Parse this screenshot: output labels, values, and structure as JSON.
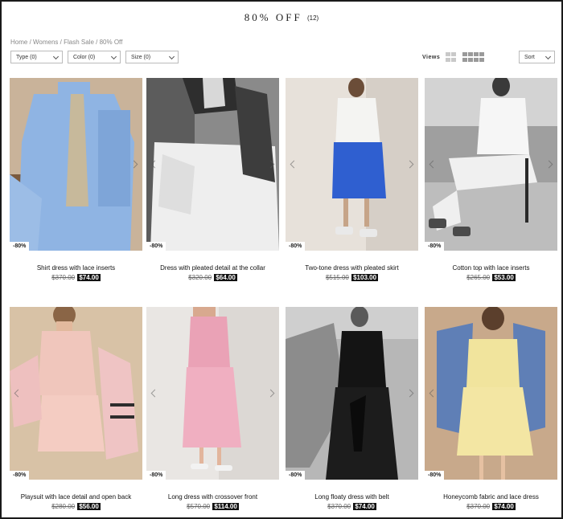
{
  "header": {
    "title": "80% OFF",
    "count": "(12)"
  },
  "breadcrumb": [
    "Home",
    "Womens",
    "Flash Sale",
    "80% Off"
  ],
  "breadcrumb_sep": " / ",
  "filters": {
    "type": "Type (0)",
    "color": "Color (0)",
    "size": "Size (0)"
  },
  "views_label": "Views",
  "sort_label": "Sort",
  "colors": {
    "price_badge_bg": "#111111",
    "price_badge_text": "#ffffff"
  },
  "products": [
    {
      "name": "Shirt dress with lace inserts",
      "old_price": "$370.00",
      "new_price": "$74.00",
      "discount": "-80%"
    },
    {
      "name": "Dress with pleated detail at the collar",
      "old_price": "$320.00",
      "new_price": "$64.00",
      "discount": "-80%"
    },
    {
      "name": "Two-tone dress with pleated skirt",
      "old_price": "$515.00",
      "new_price": "$103.00",
      "discount": "-80%"
    },
    {
      "name": "Cotton top with lace inserts",
      "old_price": "$265.00",
      "new_price": "$53.00",
      "discount": "-80%"
    },
    {
      "name": "Playsuit with lace detail and open back",
      "old_price": "$280.00",
      "new_price": "$56.00",
      "discount": "-80%"
    },
    {
      "name": "Long dress with crossover front",
      "old_price": "$570.00",
      "new_price": "$114.00",
      "discount": "-80%"
    },
    {
      "name": "Long floaty dress with belt",
      "old_price": "$370.00",
      "new_price": "$74.00",
      "discount": "-80%"
    },
    {
      "name": "Honeycomb fabric and lace dress",
      "old_price": "$370.00",
      "new_price": "$74.00",
      "discount": "-80%"
    }
  ]
}
